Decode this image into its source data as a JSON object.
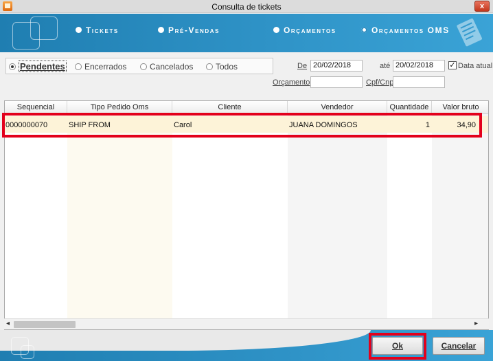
{
  "window": {
    "title": "Consulta de tickets",
    "close_label": "x"
  },
  "nav": {
    "options": [
      {
        "label": "Tickets",
        "selected": false
      },
      {
        "label": "Pré-Vendas",
        "selected": false
      },
      {
        "label": "Orçamentos",
        "selected": false
      },
      {
        "label": "Orçamentos OMS",
        "selected": true
      }
    ]
  },
  "status_filter": {
    "options": [
      {
        "label": "Pendentes",
        "selected": true
      },
      {
        "label": "Encerrados",
        "selected": false
      },
      {
        "label": "Cancelados",
        "selected": false
      },
      {
        "label": "Todos",
        "selected": false
      }
    ]
  },
  "filters": {
    "de_label": "De",
    "de_value": "20/02/2018",
    "ate_label": "até",
    "ate_value": "20/02/2018",
    "data_atual_label": "Data atual",
    "data_atual_checked": true,
    "orcamento_label": "Orçamento",
    "orcamento_value": "",
    "cpf_label": "Cpf/Cnpj",
    "cpf_value": ""
  },
  "grid": {
    "columns": [
      "Sequencial",
      "Tipo Pedido Oms",
      "Cliente",
      "Vendedor",
      "Quantidade",
      "Valor bruto"
    ],
    "rows": [
      {
        "sequencial": "0000000070",
        "tipo_pedido_oms": "SHIP FROM",
        "cliente": "Carol",
        "vendedor": "JUANA DOMINGOS",
        "quantidade": "1",
        "valor_bruto": "34,90"
      }
    ]
  },
  "buttons": {
    "ok": "Ok",
    "cancelar": "Cancelar"
  },
  "colors": {
    "header_blue": "#2a8bbf",
    "row_highlight": "#fdf3d8",
    "callout_red": "#e3001b"
  }
}
